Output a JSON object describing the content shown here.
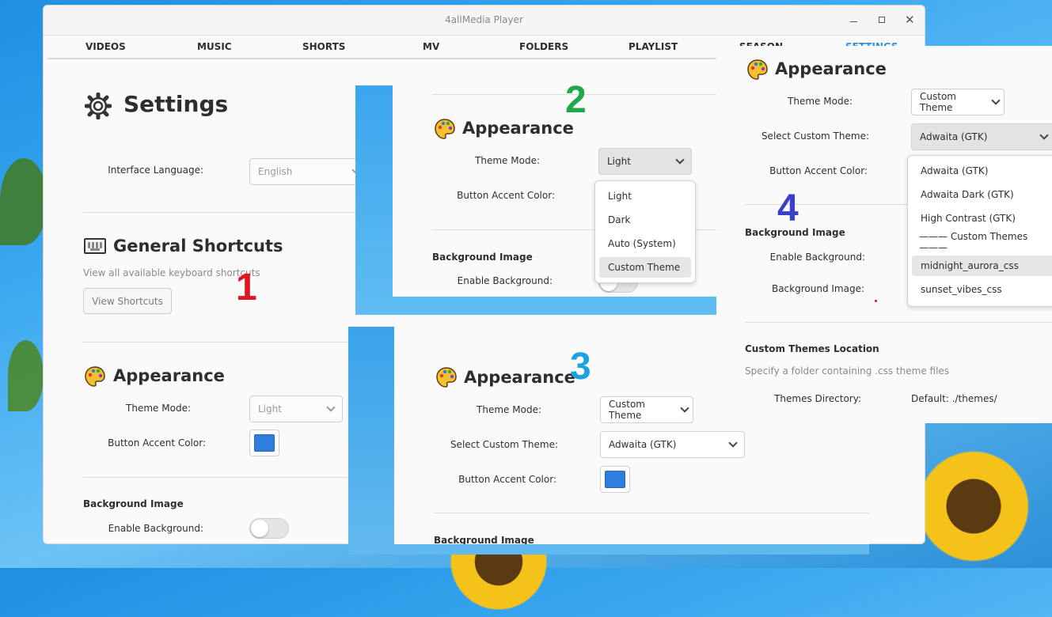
{
  "window": {
    "title": "4allMedia Player",
    "tabs": [
      "VIDEOS",
      "MUSIC",
      "SHORTS",
      "MV",
      "FOLDERS",
      "PLAYLIST",
      "SEASON",
      "SETTINGS"
    ]
  },
  "panel1": {
    "settings_title": "Settings",
    "lang_label": "Interface Language:",
    "lang_value": "English",
    "shortcuts_title": "General Shortcuts",
    "shortcuts_desc": "View all available keyboard shortcuts",
    "shortcuts_button": "View Shortcuts",
    "appearance_title": "Appearance",
    "theme_label": "Theme Mode:",
    "theme_value": "Light",
    "accent_label": "Button Accent Color:",
    "bg_section": "Background Image",
    "enable_bg_label": "Enable Background:"
  },
  "panel2": {
    "appearance_title": "Appearance",
    "theme_label": "Theme Mode:",
    "theme_value": "Light",
    "accent_label": "Button Accent Color:",
    "bg_section": "Background Image",
    "enable_bg_label": "Enable Background:",
    "menu_items": [
      "Light",
      "Dark",
      "Auto (System)",
      "Custom Theme"
    ],
    "selected_item": "Custom Theme"
  },
  "panel3": {
    "appearance_title": "Appearance",
    "theme_label": "Theme Mode:",
    "theme_value": "Custom Theme",
    "custom_label": "Select Custom Theme:",
    "custom_value": "Adwaita (GTK)",
    "accent_label": "Button Accent Color:",
    "bg_section": "Background Image"
  },
  "panel4": {
    "appearance_title": "Appearance",
    "theme_label": "Theme Mode:",
    "theme_value": "Custom Theme",
    "custom_label": "Select Custom Theme:",
    "custom_value": "Adwaita (GTK)",
    "accent_label": "Button Accent Color:",
    "bg_section": "Background Image",
    "enable_bg_label": "Enable Background:",
    "bg_image_label": "Background Image:",
    "themes_loc_title": "Custom Themes Location",
    "themes_loc_desc": "Specify a folder containing .css theme files",
    "themes_dir_label": "Themes Directory:",
    "themes_dir_value": "Default: ./themes/",
    "menu_items": [
      "Adwaita (GTK)",
      "Adwaita Dark (GTK)",
      "High Contrast (GTK)",
      "——— Custom Themes ———",
      "midnight_aurora_css",
      "sunset_vibes_css"
    ],
    "selected_item": "midnight_aurora_css"
  },
  "markers": [
    "1",
    "2",
    "3",
    "4"
  ],
  "colors": {
    "marker1": "#e0141e",
    "marker2": "#1fa84a",
    "marker3": "#1ba3e0",
    "marker4": "#3b3fc9",
    "accent_swatch": "#2f7ddf",
    "active_tab": "#2f8fe8"
  }
}
